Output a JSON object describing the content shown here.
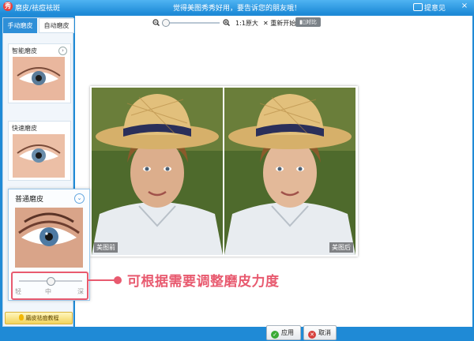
{
  "window": {
    "app_title": "磨皮/祛痘祛斑",
    "message": "觉得美图秀秀好用，要告诉您的朋友哦！",
    "feedback": "提意见",
    "close": "×"
  },
  "sidebar": {
    "tabs": [
      "手动磨皮",
      "自动磨皮"
    ],
    "active_tab": "手动磨皮",
    "items": [
      {
        "label": "智能磨皮"
      },
      {
        "label": "快速磨皮"
      }
    ],
    "expanded_item": {
      "label": "普通磨皮",
      "intensity_labels": [
        "轻",
        "中",
        "深"
      ],
      "intensity_value": 0.5
    },
    "help_button": "磨皮祛痘教程"
  },
  "toolbar": {
    "zoom_level": 0.02,
    "one_to_one": "1:1原大",
    "restart": "重新开始",
    "contrast": "对比"
  },
  "preview": {
    "before_label": "美图前",
    "after_label": "美图后"
  },
  "callout": {
    "text": "可根据需要调整磨皮力度"
  },
  "buttons": {
    "apply": "应用",
    "cancel": "取消"
  },
  "colors": {
    "accent": "#2e8fd8",
    "callout": "#e85a6f",
    "titlebar": "#1e8bd8"
  }
}
